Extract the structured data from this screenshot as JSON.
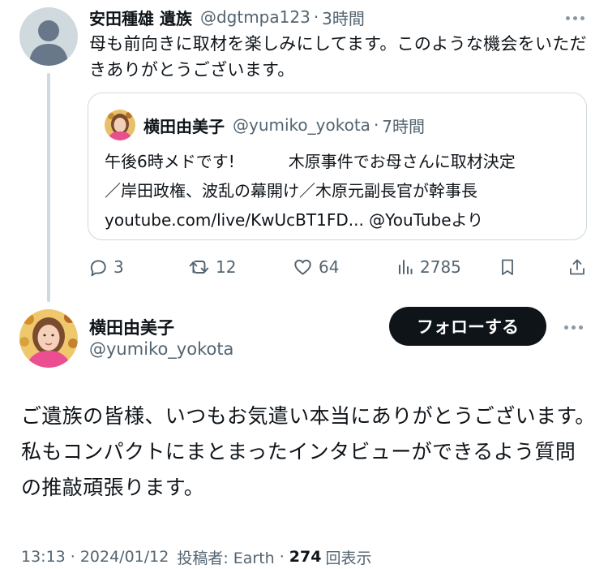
{
  "reply": {
    "name": "安田種雄 遺族",
    "handle": "@dgtmpa123",
    "separator": "·",
    "time": "3時間",
    "text": "母も前向きに取材を楽しみにしてます。このような機会をいただきありがとうございます。"
  },
  "quote": {
    "name": "横田由美子",
    "handle": "@yumiko_yokota",
    "separator": "·",
    "time": "7時間",
    "line1_a": "午後6時メドです!",
    "line1_b": "木原事件でお母さんに取材決定",
    "line2": "／岸田政権、波乱の幕開け／木原元副長官が幹事長",
    "line3": "youtube.com/live/KwUcBT1FD... @YouTubeより"
  },
  "actions": {
    "replies": "3",
    "reposts": "12",
    "likes": "64",
    "views": "2785"
  },
  "icons": {
    "reply": "reply-icon",
    "repost": "repost-icon",
    "like": "heart-icon",
    "views": "views-icon",
    "bookmark": "bookmark-icon",
    "share": "share-icon",
    "more": "more-icon"
  },
  "main": {
    "name": "横田由美子",
    "handle": "@yumiko_yokota",
    "follow_label": "フォローする",
    "text": "ご遺族の皆様、いつもお気遣い本当にありがとうございます。　私もコンパクトにまとまったインタビューができるよう質問の推敲頑張ります。",
    "time": "13:13",
    "separator": "·",
    "date": "2024/01/12",
    "poster_label": "投稿者: Earth",
    "views_count": "274",
    "views_label": "回表示"
  },
  "colors": {
    "text": "#0f1419",
    "muted": "#536471",
    "border": "#cfd9de",
    "button": "#0f1419"
  }
}
